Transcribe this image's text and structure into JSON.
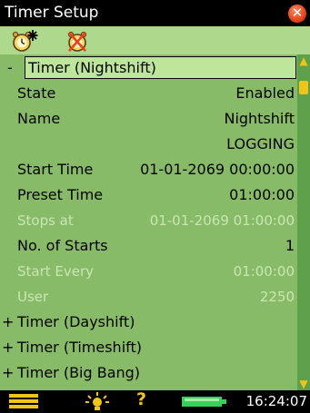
{
  "window": {
    "title": "Timer Setup",
    "close_glyph": "✕"
  },
  "toolbar": {
    "start_icon": "alarm-clock-start-icon",
    "stop_icon": "alarm-clock-stop-icon"
  },
  "timer_expanded": {
    "sign": "-",
    "name": "Timer (Nightshift)",
    "fields": [
      {
        "label": "State",
        "value": "Enabled",
        "enabled": true
      },
      {
        "label": "Name",
        "value": "Nightshift",
        "enabled": true
      },
      {
        "label": "",
        "value": "LOGGING",
        "enabled": true
      },
      {
        "label": "Start Time",
        "value": "01-01-2069 00:00:00",
        "enabled": true
      },
      {
        "label": "Preset Time",
        "value": "01:00:00",
        "enabled": true
      },
      {
        "label": "Stops at",
        "value": "01-01-2069 01:00:00",
        "enabled": false
      },
      {
        "label": "No. of Starts",
        "value": "1",
        "enabled": true
      },
      {
        "label": "Start Every",
        "value": "01:00:00",
        "enabled": false
      },
      {
        "label": "User",
        "value": "2250",
        "enabled": false
      }
    ]
  },
  "timers_collapsed": [
    {
      "sign": "+",
      "name": "Timer (Dayshift)"
    },
    {
      "sign": "+",
      "name": "Timer (Timeshift)"
    },
    {
      "sign": "+",
      "name": "Timer (Big Bang)"
    }
  ],
  "status": {
    "help_glyph": "?",
    "time": "16:24:07"
  },
  "colors": {
    "panel": "#87bb68",
    "toolbar": "#aed88b",
    "accent": "#f0c419",
    "close": "#e8431b",
    "disabled_text": "#c9e6b2"
  }
}
